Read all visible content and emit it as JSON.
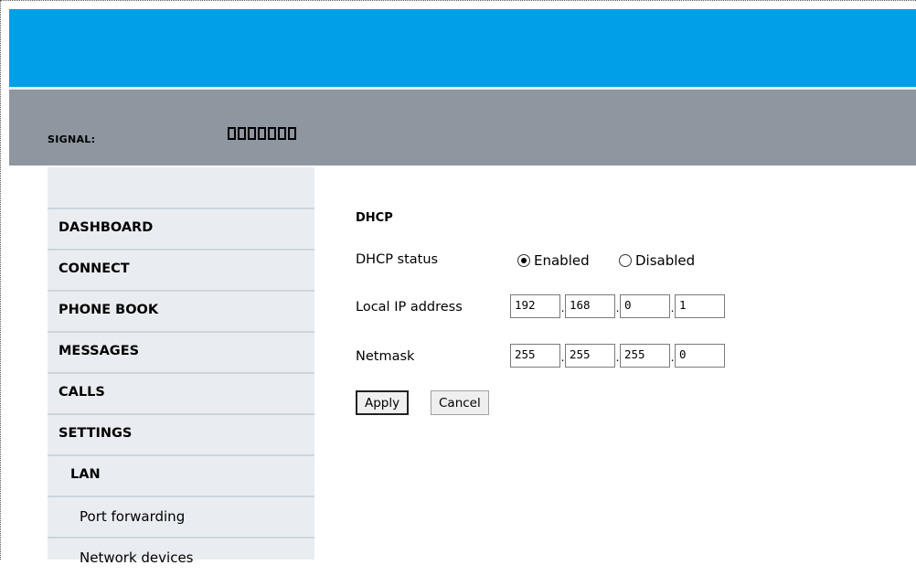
{
  "status": {
    "signal_label": "SIGNAL:",
    "signal_bars_count": 7
  },
  "nav": {
    "items": [
      {
        "label": "DASHBOARD"
      },
      {
        "label": "CONNECT"
      },
      {
        "label": "PHONE BOOK"
      },
      {
        "label": "MESSAGES"
      },
      {
        "label": "CALLS"
      },
      {
        "label": "SETTINGS"
      },
      {
        "label": "LAN"
      },
      {
        "label": "Port forwarding"
      },
      {
        "label": "Network devices"
      }
    ]
  },
  "dhcp": {
    "title": "DHCP",
    "status_label": "DHCP status",
    "enabled_label": "Enabled",
    "disabled_label": "Disabled",
    "selected": "Enabled",
    "local_ip_label": "Local IP address",
    "local_ip": [
      "192",
      "168",
      "0",
      "1"
    ],
    "netmask_label": "Netmask",
    "netmask": [
      "255",
      "255",
      "255",
      "0"
    ],
    "apply_label": "Apply",
    "cancel_label": "Cancel"
  },
  "colors": {
    "header": "#009fe7",
    "statusbar": "#8e969f",
    "sidebar": "#e9edf1"
  }
}
